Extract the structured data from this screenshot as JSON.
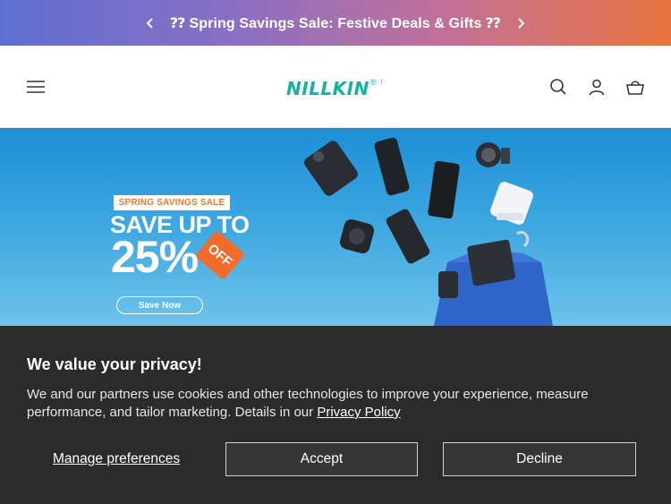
{
  "announcement": {
    "message": "⁇ Spring Savings Sale: Festive Deals & Gifts ⁇",
    "prev_icon": "chevron-left-icon",
    "next_icon": "chevron-right-icon"
  },
  "header": {
    "menu_icon": "hamburger-menu-icon",
    "logo_text": "NILLKIN",
    "logo_reg": "®",
    "logo_tail": "⁽",
    "search_icon": "search-icon",
    "account_icon": "user-icon",
    "cart_icon": "shopping-basket-icon"
  },
  "hero": {
    "badge": "SPRING SAVINGS SALE",
    "headline": "SAVE UP TO",
    "percent": "25%",
    "tag": "OFF",
    "cta": "Save Now"
  },
  "cookie_banner": {
    "title": "We value your privacy!",
    "body": "We and our partners use cookies and other technologies to improve your experience, measure performance, and tailor marketing. Details in our ",
    "policy_link": "Privacy Policy",
    "manage_label": "Manage preferences",
    "accept_label": "Accept",
    "decline_label": "Decline"
  },
  "colors": {
    "brand": "#13b3a3",
    "announce_start": "#5f6fd0",
    "announce_end": "#e8743f",
    "cookie_bg": "#2b2b2b",
    "sale_orange": "#f26b2a"
  }
}
